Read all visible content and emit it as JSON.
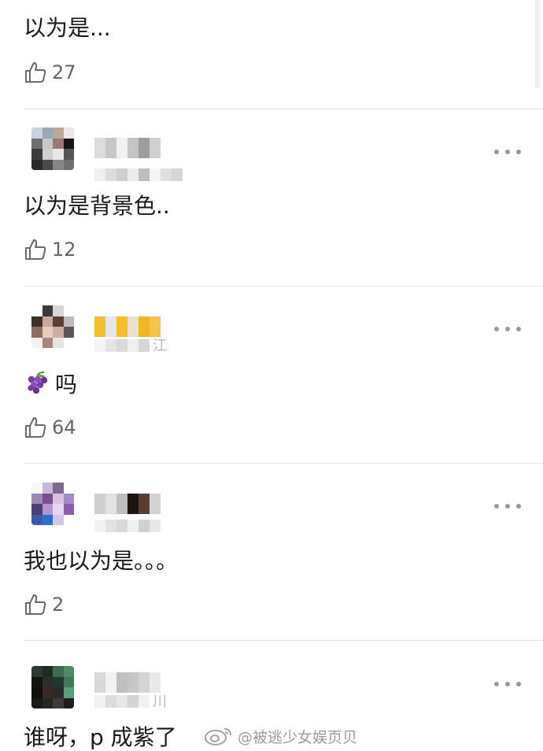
{
  "comments": [
    {
      "text": "以为是...",
      "likes": "27"
    },
    {
      "text": "以为是背景色..",
      "likes": "12"
    },
    {
      "meta_tail": "江",
      "text": "吗",
      "emoji_icon": "grapes-icon",
      "likes": "64"
    },
    {
      "text": "我也以为是。。。",
      "likes": "2"
    },
    {
      "meta_tail": "川",
      "text": "谁呀，p 成紫了"
    }
  ],
  "watermark": {
    "text": "@被逃少女娱页贝",
    "icon": "weibo-icon"
  },
  "colors": {
    "divider": "#e7e7e7",
    "like_count": "#666666",
    "more_dots": "#9a9a9a",
    "grape": "#7b3ea8"
  }
}
